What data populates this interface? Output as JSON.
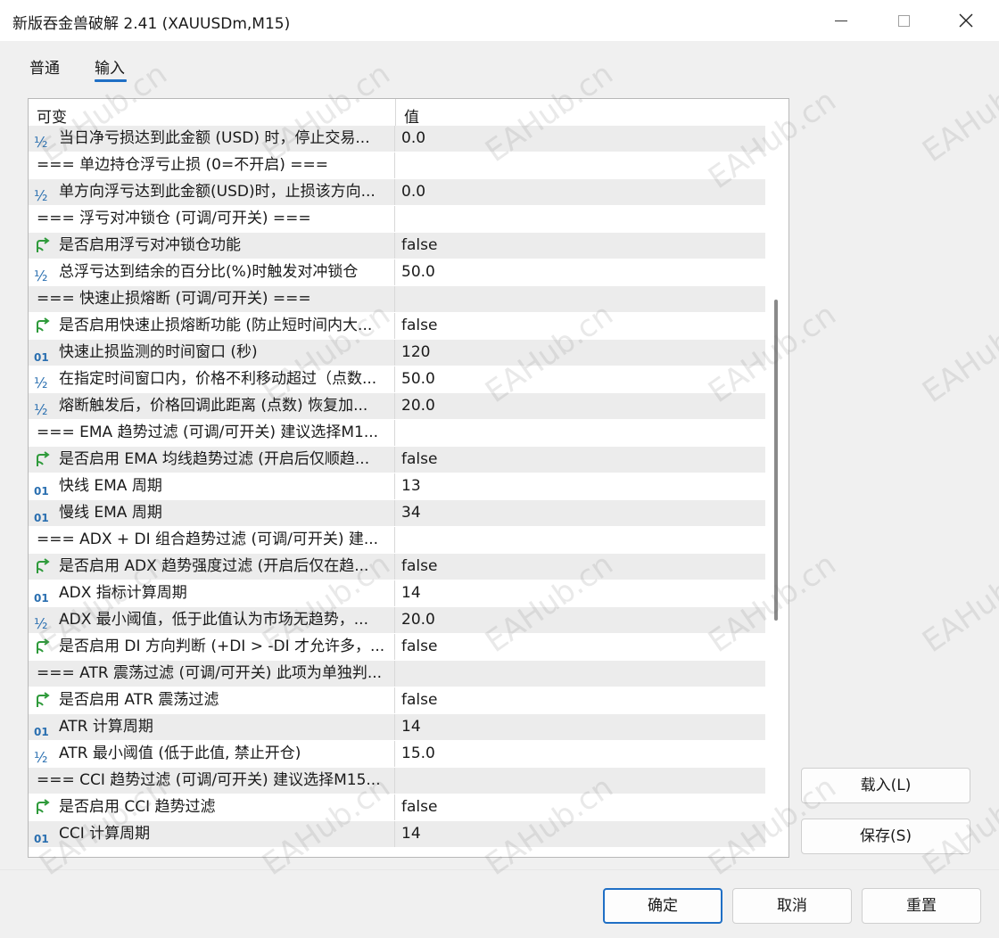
{
  "window": {
    "title": "新版吞金兽破解 2.41 (XAUUSDm,M15)"
  },
  "tabs": [
    {
      "label": "普通"
    },
    {
      "label": "输入"
    }
  ],
  "grid": {
    "columns": [
      "可变",
      "值"
    ],
    "rows": [
      {
        "icon": "frac",
        "name": "当日净亏损达到此金额 (USD) 时，停止交易...",
        "value": "0.0"
      },
      {
        "icon": "none",
        "name": "=== 单边持仓浮亏止损 (0=不开启) ===",
        "value": ""
      },
      {
        "icon": "frac",
        "name": "单方向浮亏达到此金额(USD)时，止损该方向...",
        "value": "0.0"
      },
      {
        "icon": "none",
        "name": "=== 浮亏对冲锁仓 (可调/可开关) ===",
        "value": ""
      },
      {
        "icon": "bool",
        "name": "是否启用浮亏对冲锁仓功能",
        "value": "false"
      },
      {
        "icon": "frac",
        "name": "总浮亏达到结余的百分比(%)时触发对冲锁仓",
        "value": "50.0"
      },
      {
        "icon": "none",
        "name": "=== 快速止损熔断 (可调/可开关) ===",
        "value": ""
      },
      {
        "icon": "bool",
        "name": "是否启用快速止损熔断功能 (防止短时间内大...",
        "value": "false"
      },
      {
        "icon": "int",
        "name": "快速止损监测的时间窗口 (秒)",
        "value": "120"
      },
      {
        "icon": "frac",
        "name": "在指定时间窗口内，价格不利移动超过（点数...",
        "value": "50.0"
      },
      {
        "icon": "frac",
        "name": "熔断触发后，价格回调此距离 (点数) 恢复加...",
        "value": "20.0"
      },
      {
        "icon": "none",
        "name": "=== EMA 趋势过滤 (可调/可开关) 建议选择M1...",
        "value": ""
      },
      {
        "icon": "bool",
        "name": "是否启用 EMA 均线趋势过滤 (开启后仅顺趋...",
        "value": "false"
      },
      {
        "icon": "int",
        "name": "快线 EMA 周期",
        "value": "13"
      },
      {
        "icon": "int",
        "name": "慢线 EMA 周期",
        "value": "34"
      },
      {
        "icon": "none",
        "name": "=== ADX + DI 组合趋势过滤 (可调/可开关) 建...",
        "value": ""
      },
      {
        "icon": "bool",
        "name": "是否启用 ADX 趋势强度过滤 (开启后仅在趋...",
        "value": "false"
      },
      {
        "icon": "int",
        "name": "ADX 指标计算周期",
        "value": "14"
      },
      {
        "icon": "frac",
        "name": "ADX 最小阈值，低于此值认为市场无趋势，...",
        "value": "20.0"
      },
      {
        "icon": "bool",
        "name": "是否启用 DI 方向判断 (+DI > -DI 才允许多，...",
        "value": "false"
      },
      {
        "icon": "none",
        "name": "=== ATR 震荡过滤 (可调/可开关) 此项为单独判...",
        "value": ""
      },
      {
        "icon": "bool",
        "name": "是否启用 ATR 震荡过滤",
        "value": "false"
      },
      {
        "icon": "int",
        "name": "ATR 计算周期",
        "value": "14"
      },
      {
        "icon": "frac",
        "name": "ATR 最小阈值 (低于此值, 禁止开仓)",
        "value": "15.0"
      },
      {
        "icon": "none",
        "name": "=== CCI 趋势过滤 (可调/可开关) 建议选择M15...",
        "value": ""
      },
      {
        "icon": "bool",
        "name": "是否启用 CCI 趋势过滤",
        "value": "false"
      },
      {
        "icon": "int",
        "name": "CCI 计算周期",
        "value": "14"
      }
    ]
  },
  "side_buttons": {
    "load": "载入(L)",
    "save": "保存(S)"
  },
  "footer": {
    "ok": "确定",
    "cancel": "取消",
    "reset": "重置"
  },
  "watermark": "EAHub.cn",
  "colors": {
    "accent": "#1f6fc5",
    "icon": "#2a6fb0",
    "bool_icon": "#2e9a3a"
  }
}
